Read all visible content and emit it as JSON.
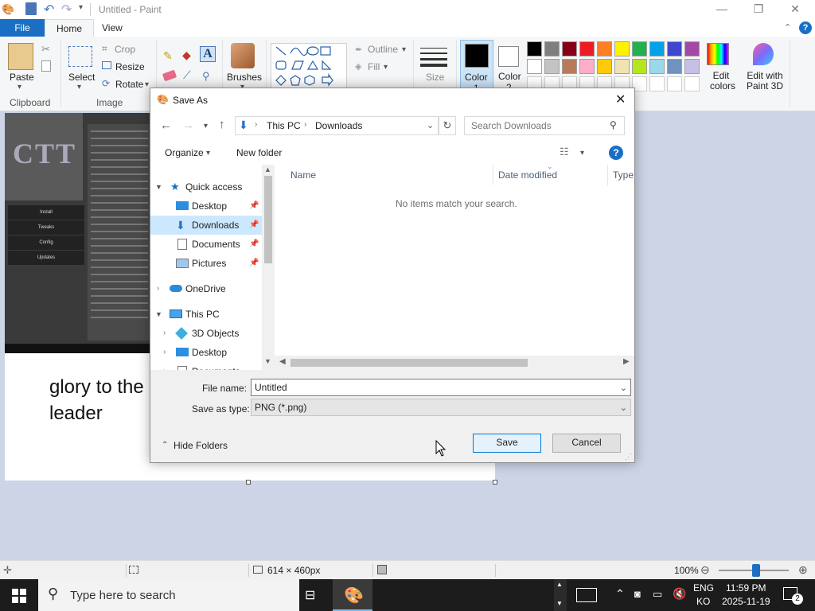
{
  "window": {
    "title": "Untitled - Paint",
    "minimize": "—",
    "maximize": "❐",
    "close": "✕"
  },
  "tabs": {
    "file": "File",
    "home": "Home",
    "view": "View"
  },
  "ribbon": {
    "clipboard": {
      "paste": "Paste",
      "group": "Clipboard"
    },
    "image": {
      "select": "Select",
      "crop": "Crop",
      "resize": "Resize",
      "rotate": "Rotate",
      "group": "Image"
    },
    "brushes": "Brushes",
    "shapes": {
      "outline": "Outline",
      "fill": "Fill"
    },
    "size": "Size",
    "color1": "Color",
    "color1_sub": "1",
    "color2": "Color",
    "color2_sub": "2",
    "edit_colors": "Edit colors",
    "edit_paint3d": "Edit with Paint 3D",
    "palette": [
      "#000000",
      "#7f7f7f",
      "#880015",
      "#ed1c24",
      "#ff7f27",
      "#fff200",
      "#22b14c",
      "#00a2e8",
      "#3f48cc",
      "#a349a4",
      "#ffffff",
      "#c3c3c3",
      "#b97a57",
      "#ffaec9",
      "#ffc90e",
      "#efe4b0",
      "#b5e61d",
      "#99d9ea",
      "#7092be",
      "#c8bfe7"
    ]
  },
  "canvas": {
    "text": "glory to the leader",
    "thumb_menu": [
      "Install",
      "Tweaks",
      "Config",
      "Updates"
    ]
  },
  "dialog": {
    "title": "Save As",
    "close": "✕",
    "breadcrumb": [
      "This PC",
      "Downloads"
    ],
    "search_placeholder": "Search Downloads",
    "organize": "Organize",
    "new_folder": "New folder",
    "nav": {
      "quick_access": "Quick access",
      "desktop": "Desktop",
      "downloads": "Downloads",
      "documents": "Documents",
      "pictures": "Pictures",
      "onedrive": "OneDrive",
      "this_pc": "This PC",
      "objects3d": "3D Objects",
      "desktop2": "Desktop",
      "documents2": "Documents"
    },
    "columns": {
      "name": "Name",
      "date": "Date modified",
      "type": "Type"
    },
    "empty": "No items match your search.",
    "file_name_label": "File name:",
    "file_name": "Untitled",
    "save_type_label": "Save as type:",
    "save_type": "PNG (*.png)",
    "hide_folders": "Hide Folders",
    "save": "Save",
    "cancel": "Cancel"
  },
  "status": {
    "dimensions": "614 × 460px",
    "zoom": "100%"
  },
  "taskbar": {
    "search_placeholder": "Type here to search",
    "lang1": "ENG",
    "lang2": "KO",
    "time": "11:59 PM",
    "date": "2025-11-19",
    "notifications": "2"
  }
}
